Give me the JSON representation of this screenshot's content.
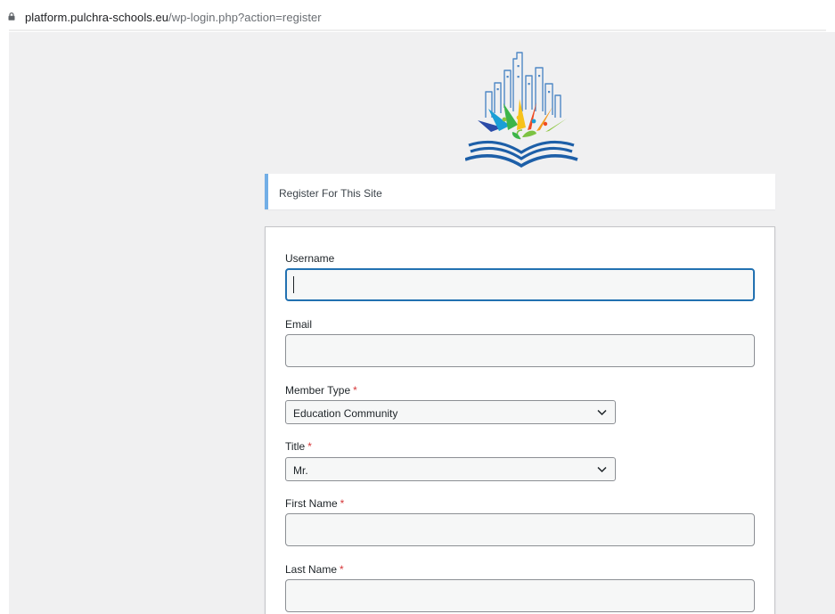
{
  "browser": {
    "url_host": "platform.pulchra-schools.eu",
    "url_path": "/wp-login.php?action=register",
    "icons": {
      "lock": "lock-icon"
    }
  },
  "notice": {
    "message": "Register For This Site"
  },
  "form": {
    "username": {
      "label": "Username",
      "value": ""
    },
    "email": {
      "label": "Email",
      "value": ""
    },
    "member_type": {
      "label": "Member Type",
      "required_mark": "*",
      "selected": "Education Community"
    },
    "title": {
      "label": "Title",
      "required_mark": "*",
      "selected": "Mr."
    },
    "first_name": {
      "label": "First Name",
      "required_mark": "*",
      "value": ""
    },
    "last_name": {
      "label": "Last Name",
      "required_mark": "*",
      "value": ""
    }
  },
  "colors": {
    "accent": "#72aee6",
    "focus": "#2271b1",
    "required": "#d63638",
    "page_background": "#f0f0f1"
  }
}
